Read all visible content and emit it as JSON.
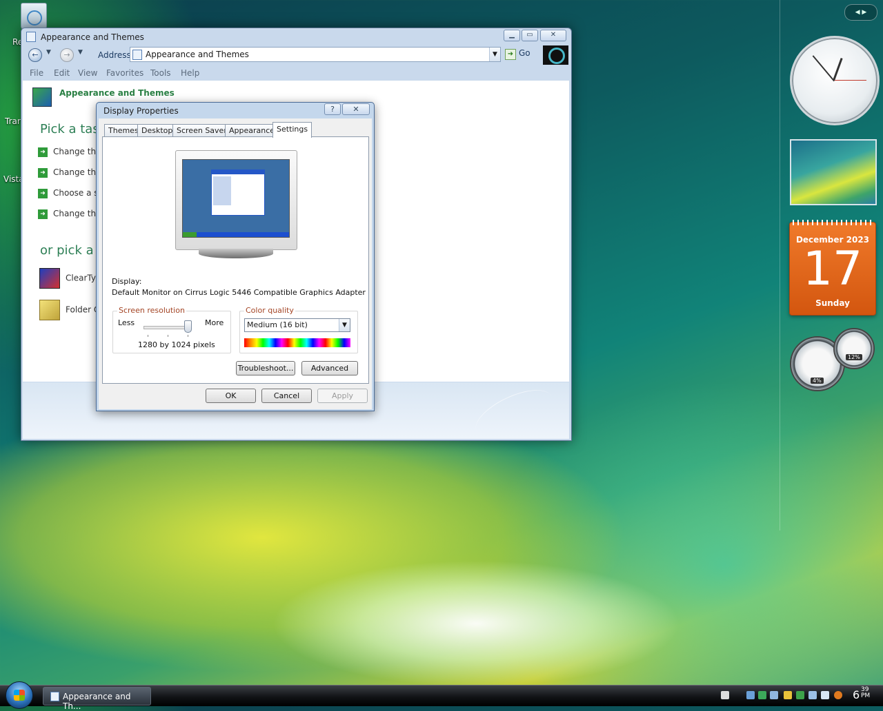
{
  "desktop": {
    "icons": [
      {
        "label": "Re"
      },
      {
        "label": "Trar"
      },
      {
        "label": "Vista"
      }
    ]
  },
  "explorer": {
    "title": "Appearance and Themes",
    "address_label": "Address",
    "address_value": "Appearance and Themes",
    "go_label": "Go",
    "menu": [
      "File",
      "Edit",
      "View",
      "Favorites",
      "Tools",
      "Help"
    ],
    "header_title": "Appearance and Themes",
    "pick_task": "Pick a task",
    "tasks": [
      "Change the",
      "Change the",
      "Choose a sc",
      "Change the"
    ],
    "pick_icon": "or pick a C",
    "items": [
      "ClearType",
      "Folder O"
    ]
  },
  "dialog": {
    "title": "Display Properties",
    "help_glyph": "?",
    "tabs": [
      "Themes",
      "Desktop",
      "Screen Saver",
      "Appearance",
      "Settings"
    ],
    "active_tab": "Settings",
    "display_label": "Display:",
    "display_value": "Default Monitor on Cirrus Logic 5446 Compatible Graphics Adapter",
    "resolution_caption": "Screen resolution",
    "less_label": "Less",
    "more_label": "More",
    "resolution_value": "1280 by 1024 pixels",
    "color_caption": "Color quality",
    "color_value": "Medium (16 bit)",
    "troubleshoot_label": "Troubleshoot...",
    "advanced_label": "Advanced",
    "ok_label": "OK",
    "cancel_label": "Cancel",
    "apply_label": "Apply"
  },
  "gadgets": {
    "calendar_month": "December 2023",
    "calendar_day": "17",
    "calendar_weekday": "Sunday",
    "cpu_meter": "4%",
    "memory_meter": "12%"
  },
  "taskbar": {
    "task_label": "Appearance and Th...",
    "clock_hour": "6",
    "clock_minute": "39",
    "clock_ampm": "PM"
  },
  "icons": {
    "back": "back-arrow-icon",
    "forward": "forward-arrow-icon",
    "go": "go-arrow-icon",
    "start": "windows-logo-icon"
  }
}
